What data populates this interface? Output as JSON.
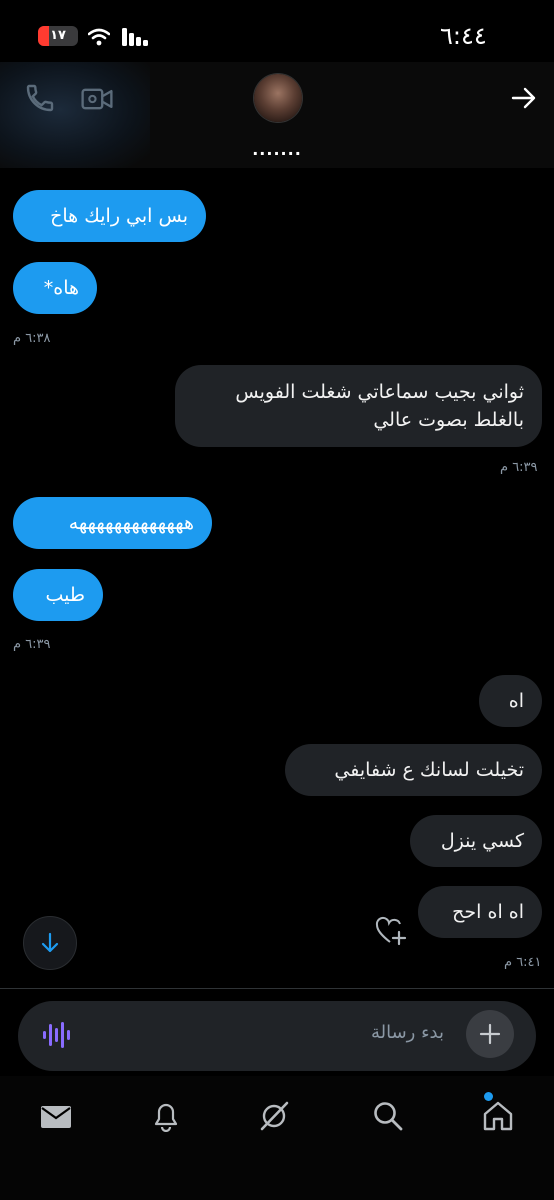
{
  "status_bar": {
    "time": "٦:٤٤",
    "battery": "١٧"
  },
  "header": {
    "contact_name": "......."
  },
  "messages": [
    {
      "side": "in",
      "text": "بس ابي رايك هاخ"
    },
    {
      "side": "in",
      "text": "هاه*"
    },
    {
      "side": "out",
      "text": "ثواني بجيب سماعاتي شغلت الفويس بالغلط بصوت عالي"
    },
    {
      "side": "in",
      "text": "هههههههههههههه"
    },
    {
      "side": "in",
      "text": "طيب"
    },
    {
      "side": "out",
      "text": "اه"
    },
    {
      "side": "out",
      "text": "تخيلت لسانك ع شفايفي"
    },
    {
      "side": "out",
      "text": "كسي ينزل"
    },
    {
      "side": "out",
      "text": "اه اه احح"
    }
  ],
  "timestamps": [
    "٦:٣٨ م",
    "٦:٣٩ م",
    "٦:٣٩ م",
    "٦:٤١ م"
  ],
  "composer": {
    "placeholder": "بدء رسالة"
  },
  "icons": {
    "header": [
      "phone-icon",
      "video-call-icon",
      "forward-arrow-icon"
    ],
    "composer": [
      "voice-waveform-icon",
      "add-icon"
    ],
    "tabs": [
      "messages-icon",
      "notifications-icon",
      "grok-icon",
      "search-icon",
      "home-icon"
    ]
  },
  "colors": {
    "accent": "#1d9bf0",
    "outgoing_bubble": "#202327",
    "voice_icon": "#8a6cff"
  }
}
